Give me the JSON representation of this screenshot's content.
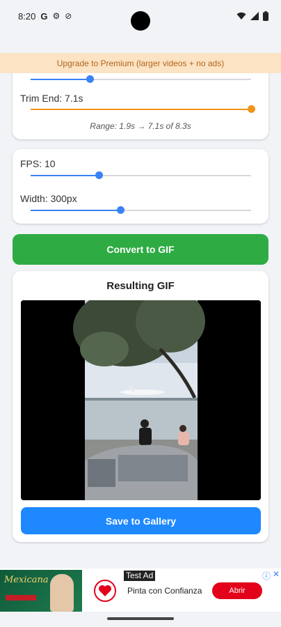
{
  "status_bar": {
    "time": "8:20"
  },
  "banner": {
    "text": "Upgrade to Premium (larger videos + no ads)"
  },
  "trim": {
    "start_value_fraction": 0.27,
    "end_label": "Trim End: 7.1s",
    "end_value_fraction": 1.0,
    "range_text": "Range: 1.9s → 7.1s of 8.3s"
  },
  "settings": {
    "fps_label": "FPS: 10",
    "fps_value_fraction": 0.31,
    "width_label": "Width: 300px",
    "width_value_fraction": 0.41
  },
  "actions": {
    "convert_label": "Convert to GIF",
    "save_label": "Save to Gallery"
  },
  "result": {
    "title": "Resulting GIF"
  },
  "ad": {
    "label": "Test Ad",
    "tagline": "Pinta con Confianza",
    "cta": "Abrir",
    "image_text": "Mexicana"
  },
  "colors": {
    "trim_start_accent": "#3b82f6",
    "trim_end_accent": "#f0961a",
    "slider_accent": "#3b82f6",
    "convert_button": "#2fab44",
    "save_button": "#1e88ff",
    "ad_cta": "#e3001b"
  }
}
